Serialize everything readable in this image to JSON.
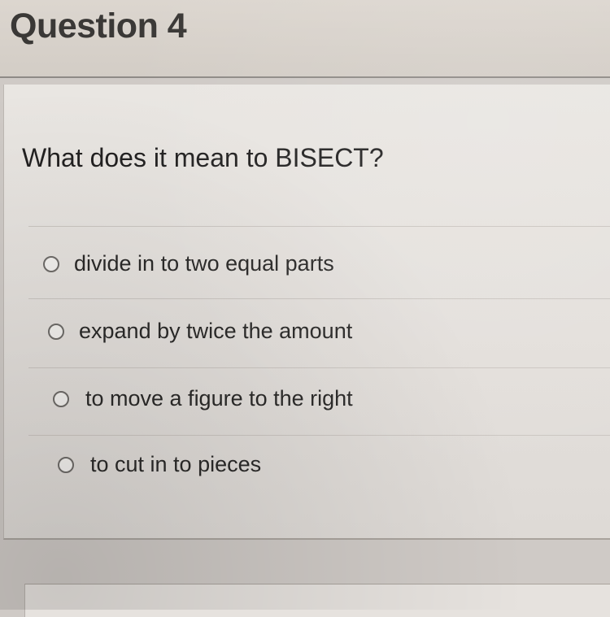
{
  "question": {
    "title": "Question 4",
    "prompt": "What does it mean to BISECT?",
    "options": [
      {
        "label": "divide in to two equal parts"
      },
      {
        "label": "expand by twice the amount"
      },
      {
        "label": "to move a figure to the right"
      },
      {
        "label": "to cut in to pieces"
      }
    ]
  }
}
